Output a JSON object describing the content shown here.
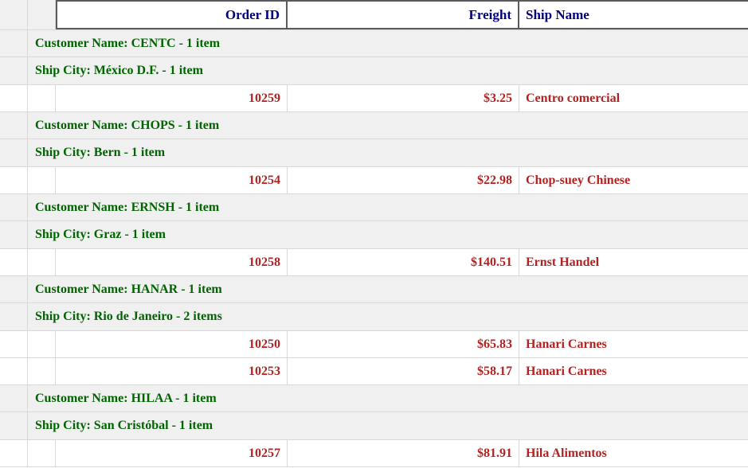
{
  "columns": {
    "order_id": "Order ID",
    "freight": "Freight",
    "ship_name": "Ship Name"
  },
  "groups": [
    {
      "customer": "Customer Name: CENTC - 1 item",
      "city": "Ship City: México D.F. - 1 item",
      "rows": [
        {
          "order_id": "10259",
          "freight": "$3.25",
          "ship_name": "Centro comercial"
        }
      ]
    },
    {
      "customer": "Customer Name: CHOPS - 1 item",
      "city": "Ship City: Bern - 1 item",
      "rows": [
        {
          "order_id": "10254",
          "freight": "$22.98",
          "ship_name": "Chop-suey Chinese"
        }
      ]
    },
    {
      "customer": "Customer Name: ERNSH - 1 item",
      "city": "Ship City: Graz - 1 item",
      "rows": [
        {
          "order_id": "10258",
          "freight": "$140.51",
          "ship_name": "Ernst Handel"
        }
      ]
    },
    {
      "customer": "Customer Name: HANAR - 1 item",
      "city": "Ship City: Rio de Janeiro - 2 items",
      "rows": [
        {
          "order_id": "10250",
          "freight": "$65.83",
          "ship_name": "Hanari Carnes"
        },
        {
          "order_id": "10253",
          "freight": "$58.17",
          "ship_name": "Hanari Carnes"
        }
      ]
    },
    {
      "customer": "Customer Name: HILAA - 1 item",
      "city": "Ship City: San Cristóbal - 1 item",
      "rows": [
        {
          "order_id": "10257",
          "freight": "$81.91",
          "ship_name": "Hila Alimentos"
        }
      ]
    }
  ],
  "colors": {
    "header_text": "#000080",
    "group_text": "#006400",
    "data_text": "#b22222"
  }
}
